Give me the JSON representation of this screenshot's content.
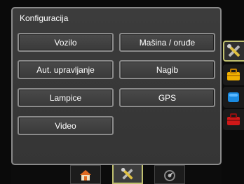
{
  "panel": {
    "title": "Konfiguracija"
  },
  "buttons": {
    "vozilo": "Vozilo",
    "masina": "Mašina / oruđe",
    "aut_upravljanje": "Aut. upravljanje",
    "nagib": "Nagib",
    "lampice": "Lampice",
    "gps": "GPS",
    "video": "Video"
  },
  "side_tabs": [
    {
      "icon": "tools-icon",
      "active": true
    },
    {
      "icon": "toolbox-icon",
      "active": false
    },
    {
      "icon": "blue-square-icon",
      "active": false
    },
    {
      "icon": "red-toolbox-icon",
      "active": false
    }
  ],
  "bottom_tabs": [
    {
      "icon": "home-icon",
      "active": false
    },
    {
      "icon": "tools-icon",
      "active": true
    },
    {
      "icon": "gauge-icon",
      "active": false
    }
  ],
  "colors": {
    "accent": "#c0c070",
    "button_border": "#8b8b8b",
    "panel_bg": "#3a3a3a"
  }
}
